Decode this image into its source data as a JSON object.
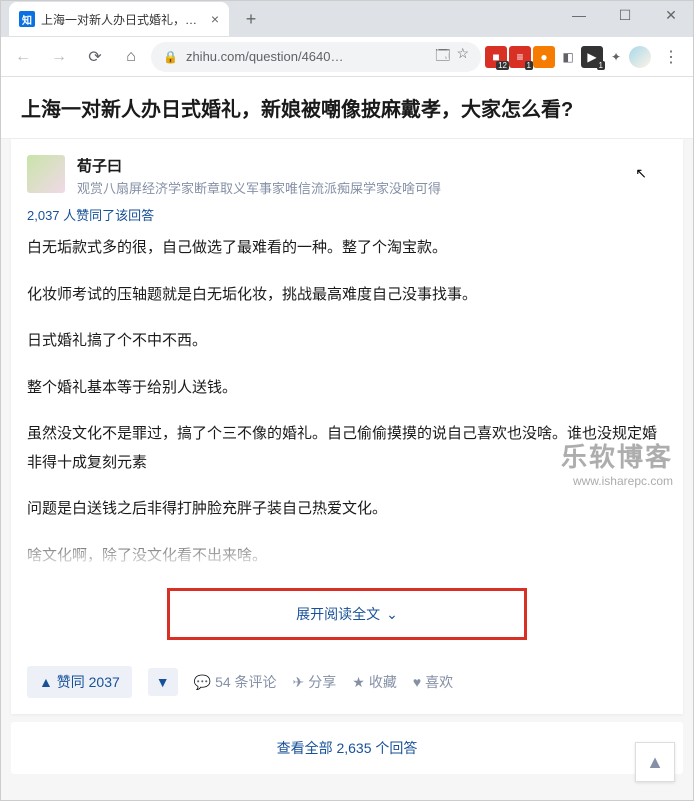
{
  "window": {
    "minimize": "—",
    "maximize": "☐",
    "close": "✕"
  },
  "browser": {
    "favicon_text": "知",
    "tab_title": "上海一对新人办日式婚礼，新娘…",
    "tab_close": "×",
    "new_tab": "+",
    "back": "←",
    "forward": "→",
    "reload": "⟳",
    "home": "⌂",
    "lock": "🔒",
    "url": "zhihu.com/question/4640…",
    "translate": "🗔",
    "star": "☆",
    "ext_badges": {
      "b1": "12",
      "b2": "1",
      "b3": "1"
    },
    "puzzle": "✦",
    "user_circle": "●",
    "menu": "⋮"
  },
  "page": {
    "question_title": "上海一对新人办日式婚礼，新娘被嘲像披麻戴孝，大家怎么看?",
    "author": {
      "name": "荀子曰",
      "bio": "观赏八扇屏经济学家断章取义军事家唯信流派痴屎学家没啥可得"
    },
    "upvote_line": "2,037 人赞同了该回答",
    "paragraphs": [
      "白无垢款式多的很，自己做选了最难看的一种。整了个淘宝款。",
      "化妆师考试的压轴题就是白无垢化妆，挑战最高难度自己没事找事。",
      "日式婚礼搞了个不中不西。",
      "整个婚礼基本等于给别人送钱。",
      "虽然没文化不是罪过，搞了个三不像的婚礼。自己偷偷摸摸的说自己喜欢也没啥。谁也没规定婚非得十成复刻元素",
      "问题是白送钱之后非得打肿脸充胖子装自己热爱文化。",
      "啥文化啊，除了没文化看不出来啥。"
    ],
    "expand": "展开阅读全文",
    "expand_arrow": "⌄",
    "actions": {
      "vote_up": "▲ 赞同 2037",
      "vote_down": "▼",
      "comments": "54 条评论",
      "share": "分享",
      "favorite": "收藏",
      "like": "喜欢"
    },
    "icons": {
      "comment": "💬",
      "share": "✈",
      "star": "★",
      "heart": "♥"
    },
    "view_all": "查看全部 2,635 个回答",
    "back_top": "▲"
  },
  "watermark": {
    "cn": "乐软博客",
    "en": "www.isharepc.com"
  }
}
